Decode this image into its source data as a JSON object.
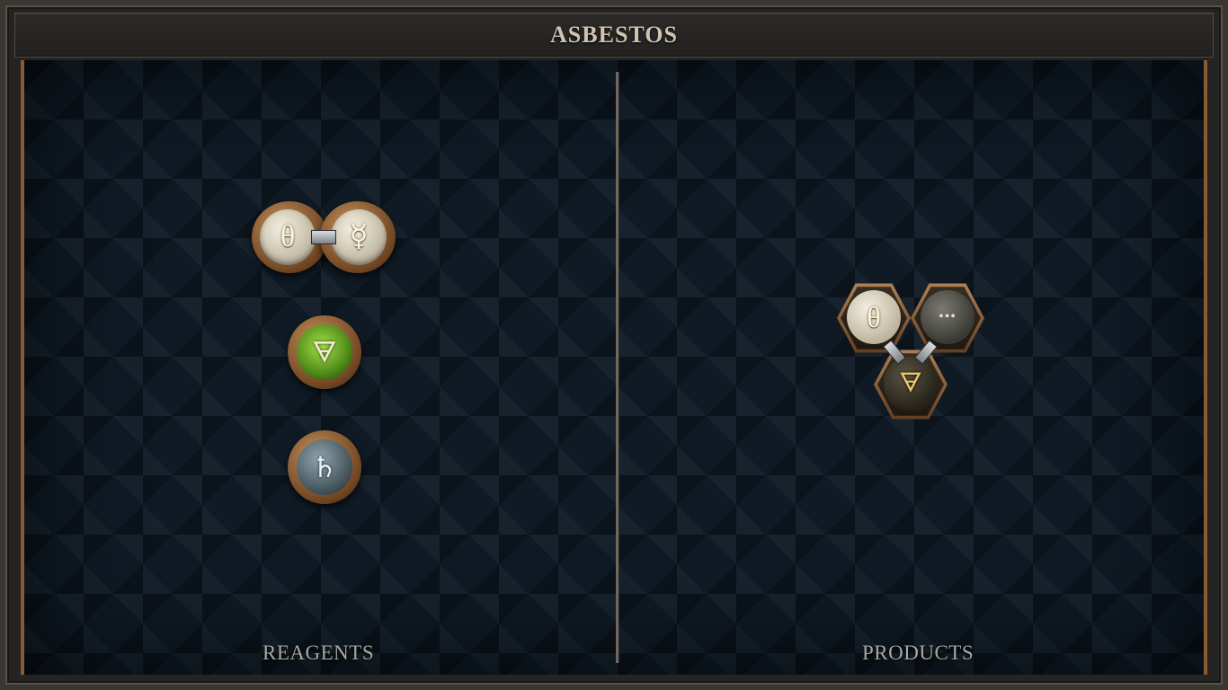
{
  "title": "ASBESTOS",
  "panels": {
    "reagents_label": "REAGENTS",
    "products_label": "PRODUCTS"
  },
  "reagents": [
    {
      "atoms": [
        {
          "element": "salt",
          "symbol": "θ"
        },
        {
          "element": "quicksilver",
          "symbol": "☿"
        }
      ],
      "bonds": 1
    },
    {
      "atoms": [
        {
          "element": "earth",
          "symbol": "🜃"
        }
      ]
    },
    {
      "atoms": [
        {
          "element": "lead",
          "symbol": "♄"
        }
      ]
    }
  ],
  "products": [
    {
      "atoms": [
        {
          "element": "salt",
          "symbol": "θ"
        },
        {
          "element": "unknown",
          "symbol": "•••"
        },
        {
          "element": "earth",
          "symbol": "🜃"
        }
      ],
      "bonds": 2
    }
  ],
  "colors": {
    "board": "#0f1a24",
    "rim": "#8a5a32",
    "salt": "#d8d2c0",
    "earth": "#6fb02a",
    "lead": "#5d6e76",
    "unknown": "#4a4a44",
    "earth_product": "#3a3628"
  }
}
